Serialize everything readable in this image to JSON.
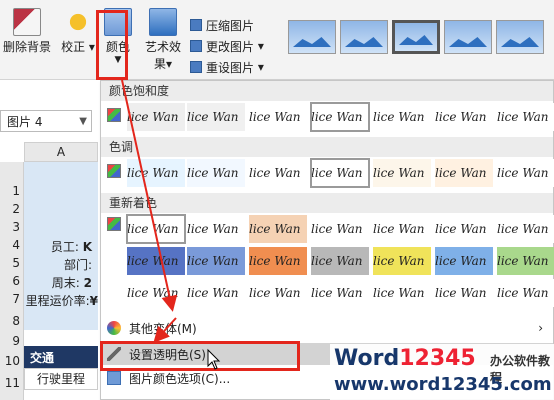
{
  "ribbon": {
    "remove_bg": "删除背景",
    "correct": "校正",
    "color": "颜色",
    "art_effects": "艺术效果",
    "compress": "压缩图片",
    "change": "更改图片",
    "reset": "重设图片"
  },
  "namebox": {
    "value": "图片 4"
  },
  "sheet": {
    "col_a": "A",
    "rows": [
      "1",
      "2",
      "3",
      "4",
      "5",
      "6",
      "7",
      "8",
      "9",
      "10",
      "11"
    ],
    "employee": "员工:",
    "dept": "部门:",
    "week_end": "周末:",
    "mileage_rate": "里程运价率:",
    "cut_k": "K",
    "cut_2": "2",
    "cut_yen": "¥",
    "header_transport": "交通",
    "trip_mileage": "行驶里程"
  },
  "panel": {
    "sat_title": "颜色饱和度",
    "tone_title": "色调",
    "recolor_title": "重新着色",
    "sample_text": "lice Wan",
    "menu_more_variants": "其他变体(M)",
    "menu_set_transparent": "设置透明色(S)",
    "menu_color_options": "图片颜色选项(C)..."
  },
  "watermark": {
    "brand_left": "Word",
    "brand_num": "12345",
    "brand_cn": "办公软件教程",
    "url": "www.word12345.com"
  },
  "colors": {
    "highlight_red": "#e3261c",
    "sheet_blue": "#d9e7f5",
    "header_navy": "#1f3864"
  }
}
